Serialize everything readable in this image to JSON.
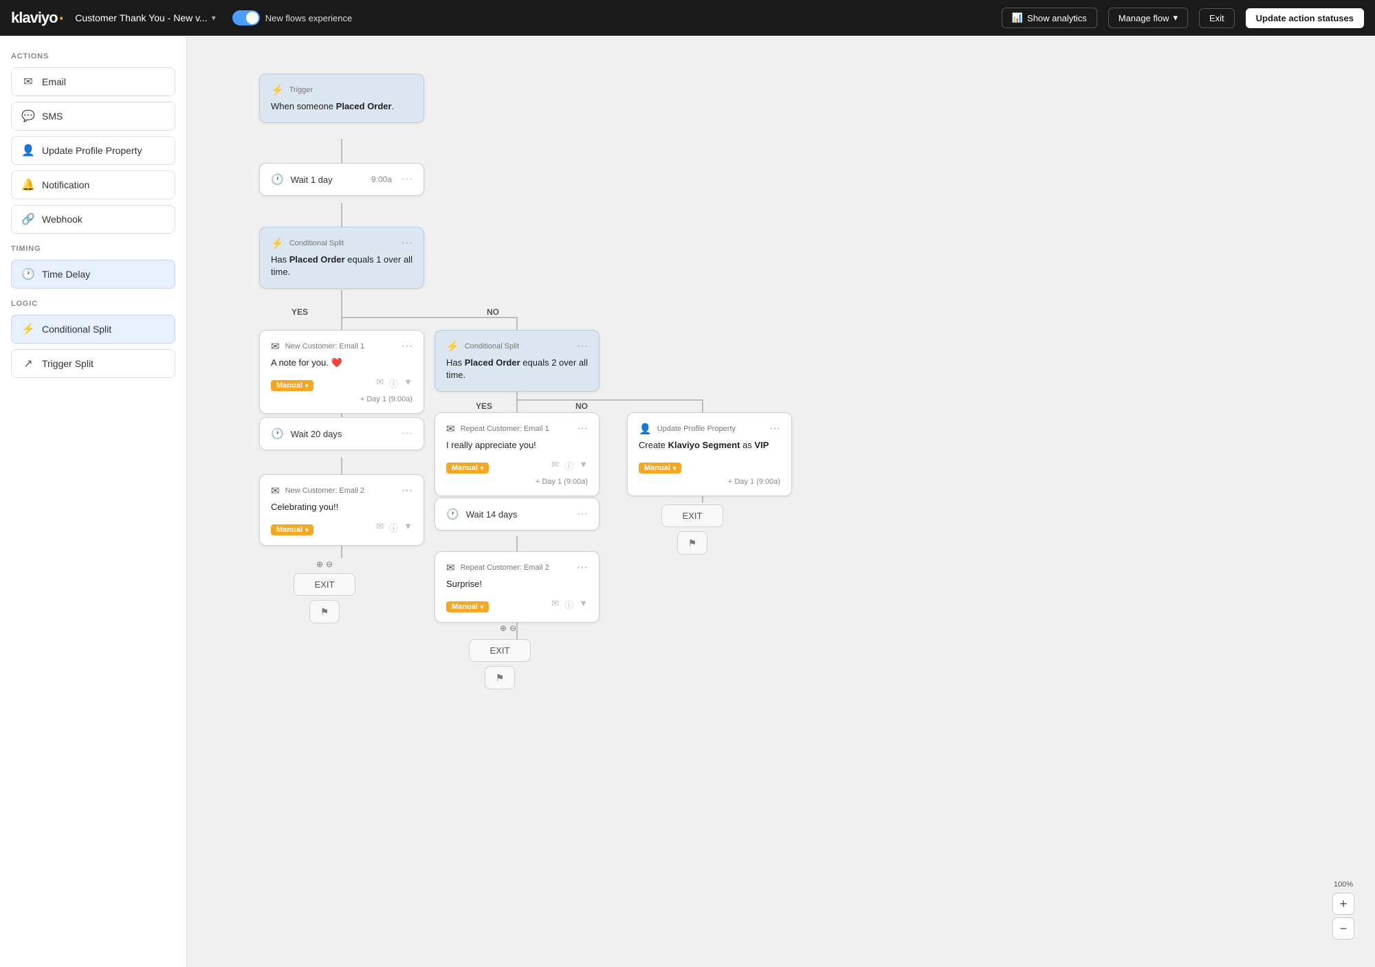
{
  "header": {
    "logo": "klaviyo",
    "logo_dot": "·",
    "flow_name": "Customer Thank You - New v...",
    "toggle_label": "New flows experience",
    "toggle_active": true,
    "show_analytics_label": "Show analytics",
    "manage_flow_label": "Manage flow",
    "exit_label": "Exit",
    "update_statuses_label": "Update action statuses"
  },
  "sidebar": {
    "actions_label": "ACTIONS",
    "timing_label": "TIMING",
    "logic_label": "LOGIC",
    "items_actions": [
      {
        "id": "email",
        "label": "Email",
        "icon": "✉"
      },
      {
        "id": "sms",
        "label": "SMS",
        "icon": "💬"
      },
      {
        "id": "update-profile",
        "label": "Update Profile Property",
        "icon": "👤"
      },
      {
        "id": "notification",
        "label": "Notification",
        "icon": "🔔"
      },
      {
        "id": "webhook",
        "label": "Webhook",
        "icon": "🔗"
      }
    ],
    "items_timing": [
      {
        "id": "time-delay",
        "label": "Time Delay",
        "icon": "🕐",
        "active": true
      }
    ],
    "items_logic": [
      {
        "id": "conditional-split",
        "label": "Conditional Split",
        "icon": "⚡",
        "active": true
      },
      {
        "id": "trigger-split",
        "label": "Trigger Split",
        "icon": "↗"
      }
    ]
  },
  "canvas": {
    "trigger": {
      "label": "Trigger",
      "body": "When someone <strong>Placed Order</strong>."
    },
    "wait1": {
      "label": "Wait 1 day",
      "time": "9:00a",
      "icon": "🕐"
    },
    "split1": {
      "label": "Conditional Split",
      "body": "Has <strong>Placed Order</strong> equals 1 over all time.",
      "yes": "YES",
      "no": "NO"
    },
    "email1": {
      "label": "New Customer: Email 1",
      "body": "A note for you. ❤️",
      "badge": "Manual",
      "day": "+ Day 1 (9:00a)"
    },
    "wait2": {
      "label": "Wait 20 days",
      "icon": "🕐"
    },
    "email2": {
      "label": "New Customer: Email 2",
      "body": "Celebrating you!!",
      "badge": "Manual",
      "day": ""
    },
    "split2": {
      "label": "Conditional Split",
      "body": "Has <strong>Placed Order</strong> equals 2 over all time.",
      "yes": "YES",
      "no": "NO"
    },
    "email3": {
      "label": "Repeat Customer: Email 1",
      "body": "I really appreciate you!",
      "badge": "Manual",
      "day": "+ Day 1 (9:00a)"
    },
    "wait3": {
      "label": "Wait 14 days",
      "icon": "🕐"
    },
    "email4": {
      "label": "Repeat Customer: Email 2",
      "body": "Surprise!",
      "badge": "Manual",
      "day": ""
    },
    "update1": {
      "label": "Update Profile Property",
      "body": "Create <strong>Klaviyo Segment</strong> as <strong>VIP</strong>",
      "badge": "Manual",
      "day": "+ Day 1 (9:00a)"
    },
    "zoom": "100%"
  }
}
